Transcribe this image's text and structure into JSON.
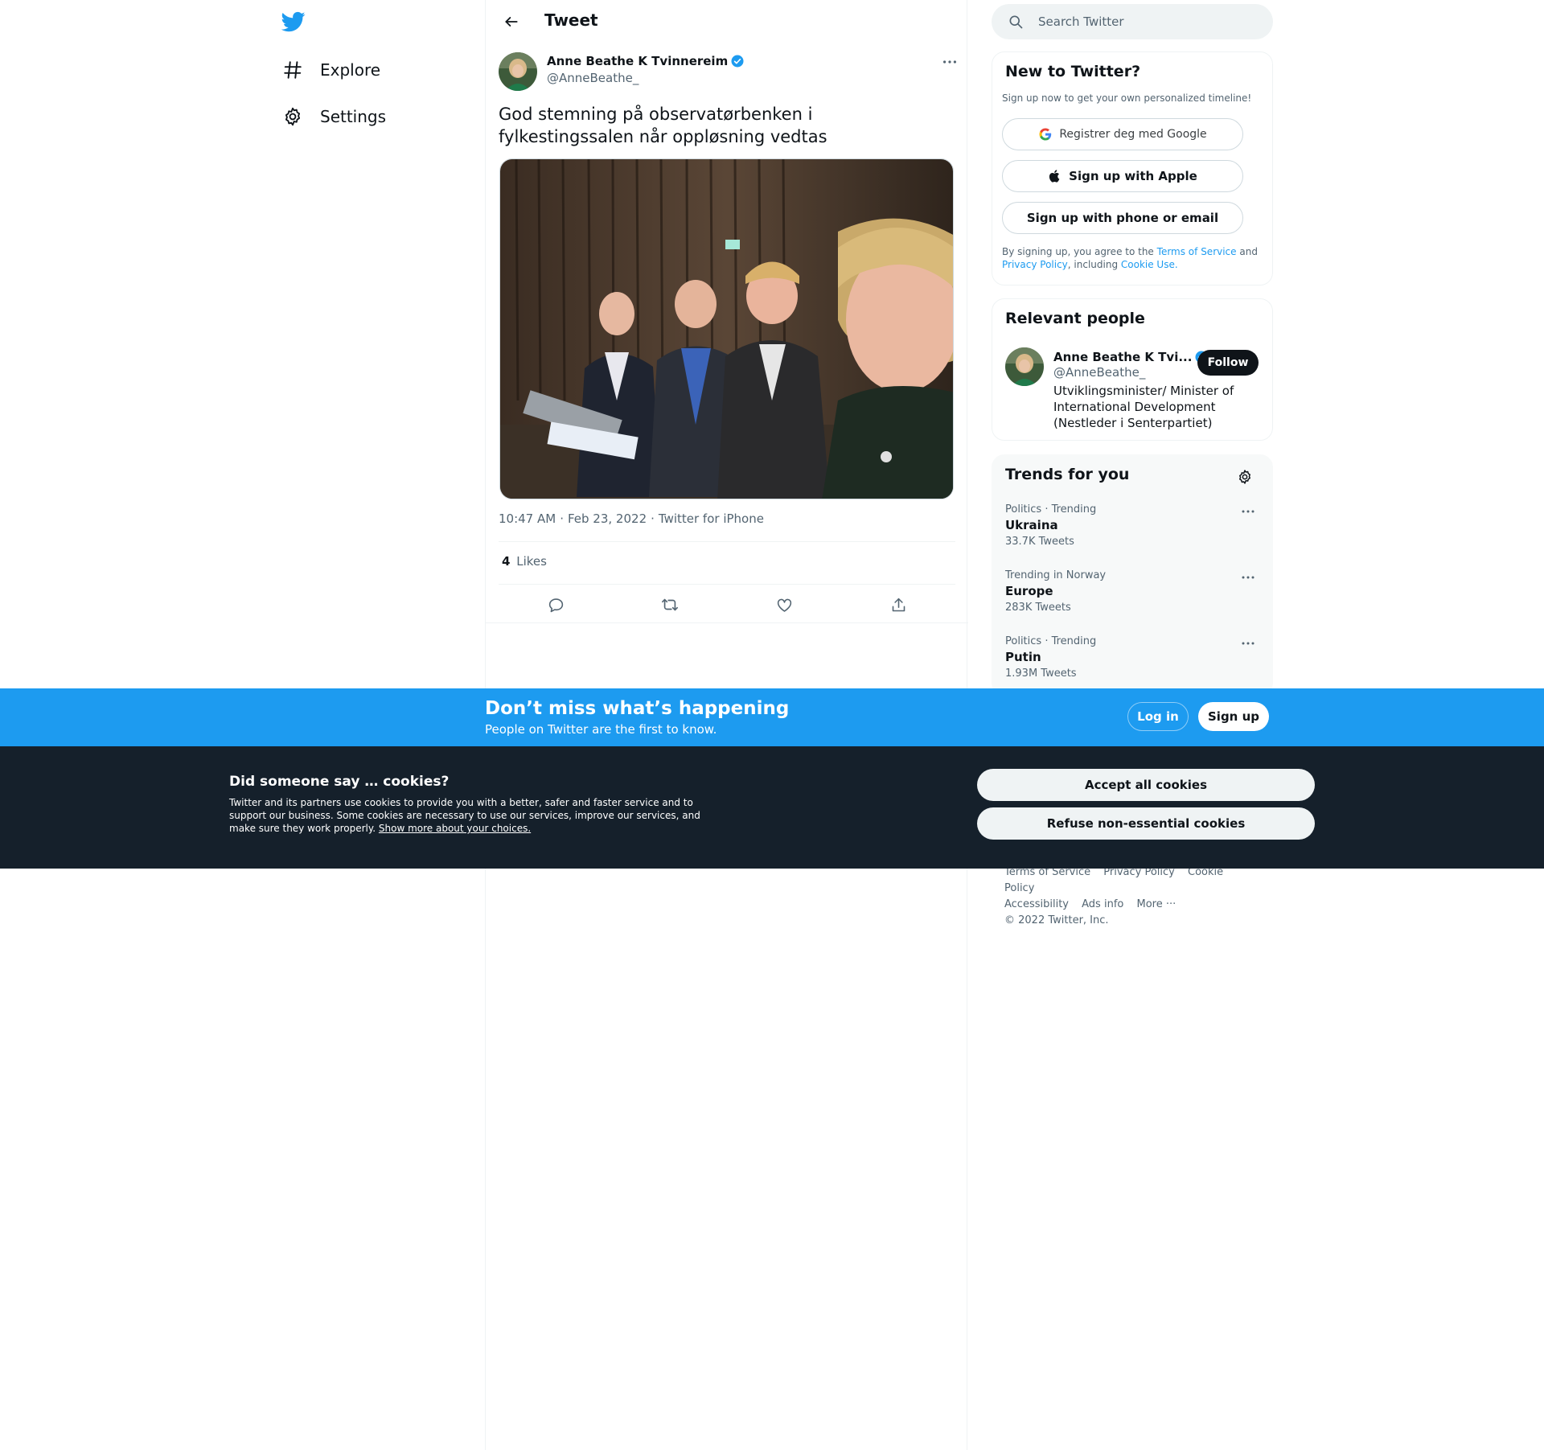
{
  "nav": {
    "logo_icon": "twitter-bird-icon",
    "items": [
      {
        "label": "Explore",
        "icon": "hashtag-icon"
      },
      {
        "label": "Settings",
        "icon": "gear-icon"
      }
    ]
  },
  "header": {
    "title": "Tweet"
  },
  "tweet": {
    "author_name": "Anne Beathe K Tvinnereim",
    "author_handle": "@AnneBeathe_",
    "text": "God stemning på observatørbenken i fylkestingssalen når oppløsning vedtas",
    "time": "10:47 AM",
    "separator": "·",
    "date": "Feb 23, 2022",
    "source": "Twitter for iPhone",
    "likes_count": "4",
    "likes_label": "Likes"
  },
  "search": {
    "placeholder": "Search Twitter"
  },
  "signup": {
    "title": "New to Twitter?",
    "subtitle": "Sign up now to get your own personalized timeline!",
    "google_label": "Registrer deg med Google",
    "apple_label": "Sign up with Apple",
    "phone_label": "Sign up with phone or email",
    "terms_prefix": "By signing up, you agree to the",
    "terms_link": "Terms of Service",
    "terms_and": "and",
    "privacy_link": "Privacy Policy",
    "terms_including": ", including",
    "cookie_link": "Cookie Use."
  },
  "relevant": {
    "title": "Relevant people",
    "name": "Anne Beathe K Tvi...",
    "handle": "@AnneBeathe_",
    "follow_label": "Follow",
    "bio": "Utviklingsminister/ Minister of International Development (Nestleder i Senterpartiet)"
  },
  "trends": {
    "title": "Trends for you",
    "items": [
      {
        "context": "Politics · Trending",
        "name": "Ukraina",
        "count": "33.7K Tweets"
      },
      {
        "context": "Trending in Norway",
        "name": "Europe",
        "count": "283K Tweets"
      },
      {
        "context": "Politics · Trending",
        "name": "Putin",
        "count": "1.93M Tweets"
      }
    ]
  },
  "footer": {
    "links": [
      "Terms of Service",
      "Privacy Policy",
      "Cookie Policy",
      "Accessibility",
      "Ads info",
      "More ···"
    ],
    "copyright": "© 2022 Twitter, Inc."
  },
  "banner": {
    "title": "Don’t miss what’s happening",
    "subtitle": "People on Twitter are the first to know.",
    "login_label": "Log in",
    "signup_label": "Sign up"
  },
  "cookies": {
    "title": "Did someone say … cookies?",
    "text": "Twitter and its partners use cookies to provide you with a better, safer and faster service and to support our business. Some cookies are necessary to use our services, improve our services, and make sure they work properly.",
    "link": "Show more about your choices.",
    "accept_label": "Accept all cookies",
    "refuse_label": "Refuse non-essential cookies"
  },
  "colors": {
    "brand_blue": "#1d9bf0",
    "text_primary": "#0f1419",
    "text_secondary": "#536471",
    "cookie_bg": "#15202b"
  }
}
